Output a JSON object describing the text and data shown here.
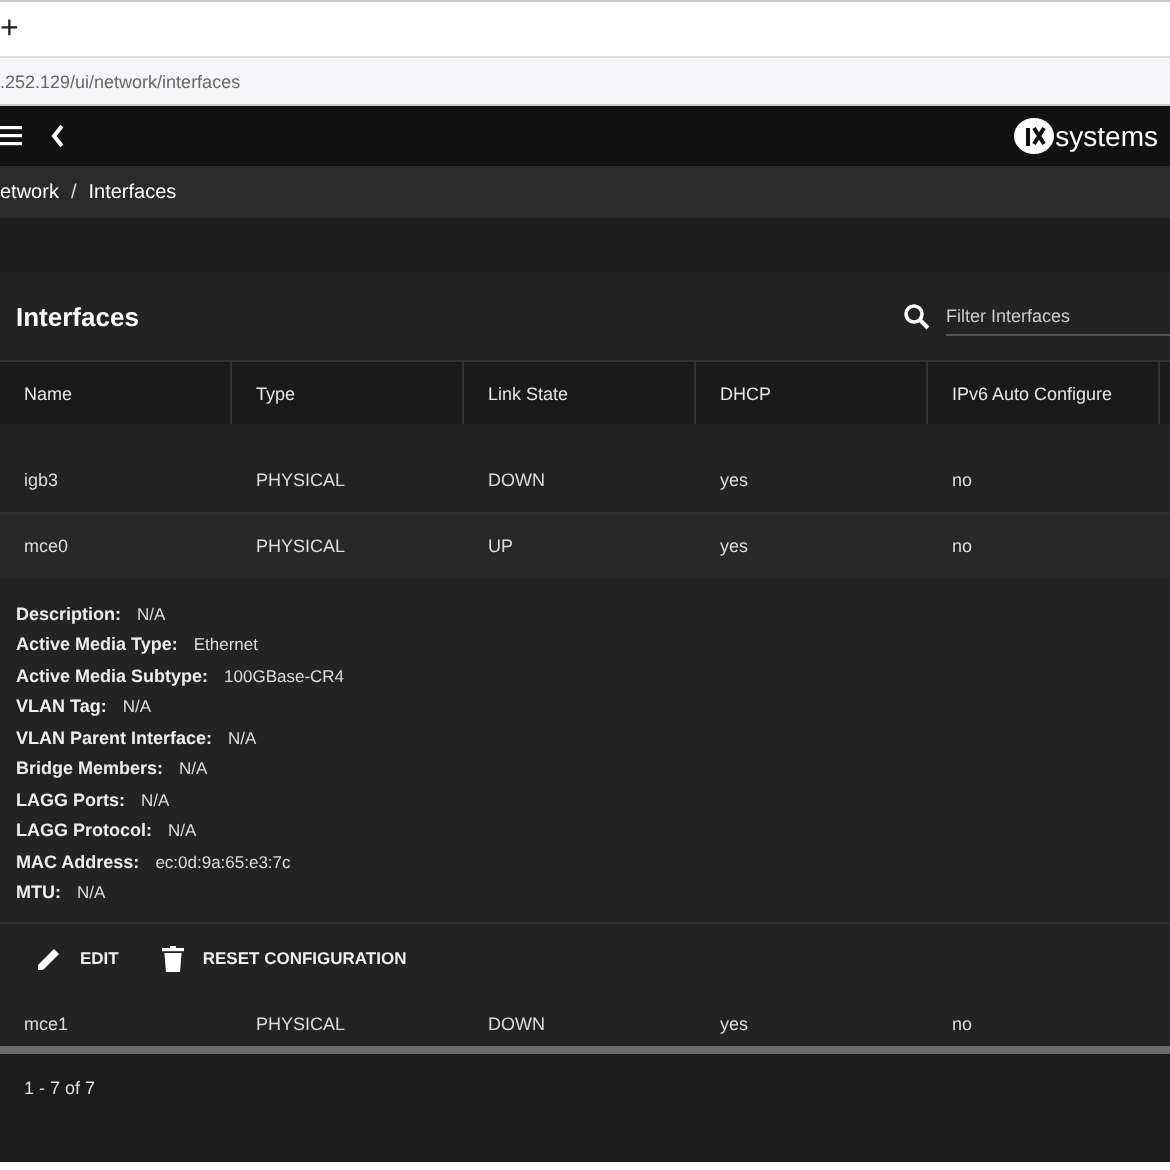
{
  "browser": {
    "new_tab": "+",
    "address": ".252.129/ui/network/interfaces"
  },
  "breadcrumb_separator": "/",
  "topbar": {
    "logo_text": "systems"
  },
  "breadcrumb": [
    "etwork",
    "Interfaces"
  ],
  "card": {
    "title": "Interfaces",
    "filter": {
      "placeholder": "Filter Interfaces"
    }
  },
  "table": {
    "columns": [
      "Name",
      "Type",
      "Link State",
      "DHCP",
      "IPv6 Auto Configure"
    ],
    "rows": [
      {
        "kind": "row",
        "cells": [
          "igb3",
          "PHYSICAL",
          "DOWN",
          "yes",
          "no"
        ]
      },
      {
        "kind": "row",
        "cells": [
          "mce0",
          "PHYSICAL",
          "UP",
          "yes",
          "no"
        ],
        "details": [
          {
            "label": "Description:",
            "value": "N/A"
          },
          {
            "label": "Active Media Type:",
            "value": "Ethernet"
          },
          {
            "label": "Active Media Subtype:",
            "value": "100GBase-CR4"
          },
          {
            "label": "VLAN Tag:",
            "value": "N/A"
          },
          {
            "label": "VLAN Parent Interface:",
            "value": "N/A"
          },
          {
            "label": "Bridge Members:",
            "value": "N/A"
          },
          {
            "label": "LAGG Ports:",
            "value": "N/A"
          },
          {
            "label": "LAGG Protocol:",
            "value": "N/A"
          },
          {
            "label": "MAC Address:",
            "value": "ec:0d:9a:65:e3:7c"
          },
          {
            "label": "MTU:",
            "value": "N/A"
          }
        ],
        "actions": [
          {
            "kind": "edit",
            "label": "EDIT"
          },
          {
            "kind": "delete",
            "label": "RESET CONFIGURATION"
          }
        ]
      },
      {
        "kind": "row",
        "cells": [
          "mce1",
          "PHYSICAL",
          "DOWN",
          "yes",
          "no"
        ]
      }
    ]
  },
  "paginator": {
    "range": "1 - 7 of 7"
  }
}
